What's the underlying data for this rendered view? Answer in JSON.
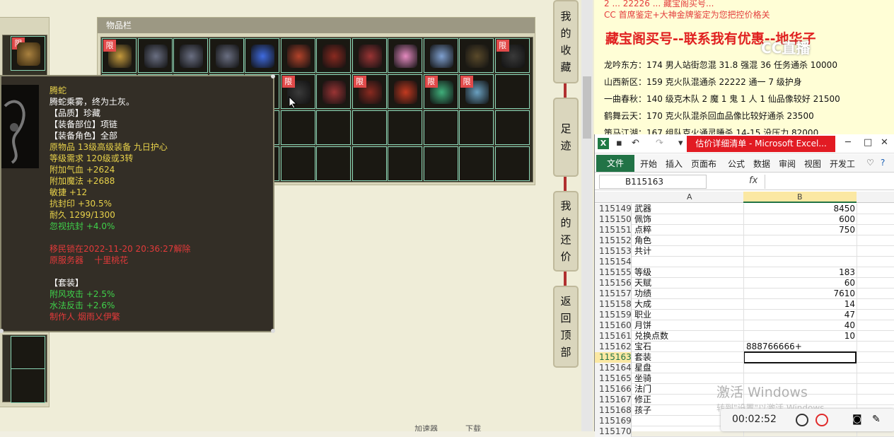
{
  "game": {
    "inventory_title": "物品栏",
    "limit_badge": "限",
    "side_buttons": [
      {
        "label": "我的收藏"
      },
      {
        "label": "足迹"
      },
      {
        "label": "我的还价"
      },
      {
        "label": "返回顶部"
      }
    ],
    "tooltip": {
      "lines": [
        {
          "text": "腾蛇",
          "color": "#e8d24a"
        },
        {
          "text": "腾蛇乘雾，终为土灰。",
          "color": "#ffffff"
        },
        {
          "text": "【品质】珍藏",
          "color": "#ffffff"
        },
        {
          "text": "【装备部位】项链",
          "color": "#ffffff"
        },
        {
          "text": "【装备角色】全部",
          "color": "#ffffff"
        },
        {
          "text": "原物品 13级高级装备 九日护心",
          "color": "#e8d24a"
        },
        {
          "text": "等级需求 120级或3转",
          "color": "#e8d24a"
        },
        {
          "text": "附加气血 +2624",
          "color": "#e8d24a"
        },
        {
          "text": "附加魔法 +2688",
          "color": "#e8d24a"
        },
        {
          "text": "敏捷 +12",
          "color": "#e8d24a"
        },
        {
          "text": "抗封印 +30.5%",
          "color": "#e8d24a"
        },
        {
          "text": "耐久 1299/1300",
          "color": "#e8d24a"
        },
        {
          "text": "忽视抗封 +4.0%",
          "color": "#3fd14a"
        },
        {
          "text": "",
          "color": "#ffffff"
        },
        {
          "text": "移民锁在2022-11-20 20:36:27解除",
          "color": "#e23a3a"
        },
        {
          "text": "原服务器    十里桃花",
          "color": "#e23a3a"
        },
        {
          "text": "",
          "color": "#ffffff"
        },
        {
          "text": "【套装】",
          "color": "#ffffff"
        },
        {
          "text": "附风攻击 +2.5%",
          "color": "#3fd14a"
        },
        {
          "text": "水法反击 +2.6%",
          "color": "#3fd14a"
        },
        {
          "text": "制作人 烟雨乂伊繁",
          "color": "#e23a3a"
        }
      ]
    },
    "status": {
      "speed": "加速器",
      "download": "下载"
    }
  },
  "ad": {
    "line1": "2 ... 22226 ... 藏宝阁买号...",
    "line2": "CC 首席鉴定+大神金牌鉴定为您把控价格关",
    "title": "藏宝阁买号--联系我有优惠--地华子",
    "logo": "CC直播",
    "lines": [
      "龙吟东方：174 男人站街忽混 31.8 强混 36 任务通杀 10000",
      "山西新区：159 克火队混通杀 22222 通一 7 级护身",
      "一曲春秋：140 级克木队 2 魔 1 鬼 1 人 1 仙品像较好 21500",
      "鹤舞云天：170 克火队混杀回血品像比较好通杀 23500",
      "策马江湖：167 组队克火通灵睡杀 14-15 没压力 82000"
    ]
  },
  "excel": {
    "window_title": "估价详细清单 - Microsoft Excel...",
    "tabs": [
      "文件",
      "开始",
      "插入",
      "页面布",
      "公式",
      "数据",
      "审阅",
      "视图",
      "开发工"
    ],
    "name_box": "B115163",
    "fx": "fx",
    "col_a": "A",
    "col_b": "B",
    "rows": [
      {
        "n": "115149",
        "a": "武器",
        "b": "8450"
      },
      {
        "n": "115150",
        "a": "佩饰",
        "b": "600"
      },
      {
        "n": "115151",
        "a": "点粹",
        "b": "750"
      },
      {
        "n": "115152",
        "a": "角色",
        "b": ""
      },
      {
        "n": "115153",
        "a": "共计",
        "b": ""
      },
      {
        "n": "115154",
        "a": "",
        "b": ""
      },
      {
        "n": "115155",
        "a": "等级",
        "b": "183"
      },
      {
        "n": "115156",
        "a": "天赋",
        "b": "60"
      },
      {
        "n": "115157",
        "a": "功绩",
        "b": "7610"
      },
      {
        "n": "115158",
        "a": "大成",
        "b": "14"
      },
      {
        "n": "115159",
        "a": "职业",
        "b": "47"
      },
      {
        "n": "115160",
        "a": "月饼",
        "b": "40"
      },
      {
        "n": "115161",
        "a": "兑换点数",
        "b": "10"
      },
      {
        "n": "115162",
        "a": "宝石",
        "b": "888766666+"
      },
      {
        "n": "115163",
        "a": "套装",
        "b": ""
      },
      {
        "n": "115164",
        "a": "星盘",
        "b": ""
      },
      {
        "n": "115165",
        "a": "坐骑",
        "b": ""
      },
      {
        "n": "115166",
        "a": "法门",
        "b": ""
      },
      {
        "n": "115167",
        "a": "修正",
        "b": ""
      },
      {
        "n": "115168",
        "a": "孩子",
        "b": ""
      },
      {
        "n": "115169",
        "a": "",
        "b": ""
      },
      {
        "n": "115170",
        "a": "",
        "b": ""
      }
    ],
    "watermark": "激活 Windows",
    "watermark_sub": "转到\"设置\"以激活 Windows。",
    "recording_time": "00:02:52"
  }
}
